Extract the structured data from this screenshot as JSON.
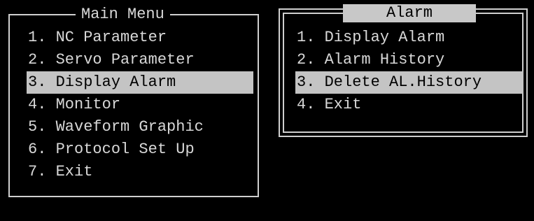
{
  "main_menu": {
    "title": "Main Menu",
    "items": [
      {
        "num": "1.",
        "label": "NC Parameter"
      },
      {
        "num": "2.",
        "label": "Servo Parameter"
      },
      {
        "num": "3.",
        "label": "Display Alarm"
      },
      {
        "num": "4.",
        "label": "Monitor"
      },
      {
        "num": "5.",
        "label": "Waveform Graphic"
      },
      {
        "num": "6.",
        "label": "Protocol Set Up"
      },
      {
        "num": "7.",
        "label": "Exit"
      }
    ],
    "selected_index": 2
  },
  "alarm_menu": {
    "title": "Alarm",
    "items": [
      {
        "num": "1.",
        "label": "Display Alarm"
      },
      {
        "num": "2.",
        "label": "Alarm History"
      },
      {
        "num": "3.",
        "label": "Delete AL.History"
      },
      {
        "num": "4.",
        "label": "Exit"
      }
    ],
    "selected_index": 2
  },
  "colors": {
    "background": "#000000",
    "text": "#d8d8d8",
    "highlight": "#c4c4c4",
    "highlight_text": "#000000"
  }
}
